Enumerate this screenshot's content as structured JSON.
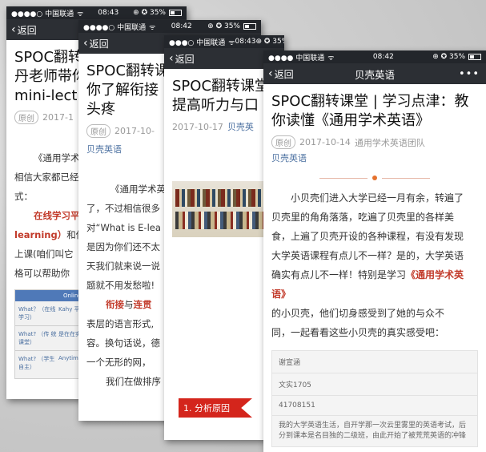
{
  "phone1": {
    "status": {
      "carrier": "●●●●○ 中国联通",
      "wifi": "ᯤ",
      "time": "08:43",
      "right": "⊕ ✪ 35%"
    },
    "back": "返回",
    "title": "SPOC翻转课堂 | 学习点津：教丹老师带你学mini-lecture",
    "title_lines": [
      "SPOC翻转",
      "丹老师带你",
      "mini-lectu"
    ],
    "tag": "原创",
    "date": "2017-1",
    "para1": "《通用学术",
    "para2": "相信大家都已经",
    "para3": "式：",
    "red1": "在线学习平",
    "red2": "learning）",
    "para4": "和你",
    "para5": "上课(咱们叫它",
    "para6": "格可以帮助你",
    "table_header": "Online lea",
    "table_rows": [
      "What？（在线 学习）",
      "What? （传 统课堂）",
      "What? （学生 自主）"
    ],
    "table_cells": [
      "Kahy 平 Rea 在平台的课程",
      "是在在实现的 来查查学是老 与课程中平学",
      "Anytime"
    ]
  },
  "phone2": {
    "status": {
      "carrier": "●●●●○ 中国联通",
      "wifi": "ᯤ",
      "time": "08:42",
      "right": "⊕ ✪ 35%"
    },
    "back": "返回",
    "title_lines": [
      "SPOC翻转课",
      "你了解衔接",
      "头疼"
    ],
    "tag": "原创",
    "date": "2017-10-",
    "author": "贝壳英语",
    "para1": "《通用学术英",
    "para2": "了，不过相信很多",
    "para3": "对“What is E-lea",
    "para4": "是因为你们还不太",
    "para5": "天我们就来说一说",
    "para6": "题就不用发愁啦!",
    "red_a": "衔接",
    "red_mid": "与",
    "red_b": "连贯",
    "para7": "表层的语言形式,",
    "para8": "容。换句话说，德",
    "para9": "一个无形的网，",
    "para10": "我们在做排序"
  },
  "phone3": {
    "status": {
      "carrier": "●●●○ 中国联通",
      "wifi": "ᯤ",
      "time": "08:43",
      "right": "⊕ ✪ 35%"
    },
    "back": "返回",
    "title_lines": [
      "SPOC翻转课堂",
      "提高听力与口"
    ],
    "date": "2017-10-17",
    "author": "贝壳英",
    "banner": "1. 分析原因"
  },
  "phone4": {
    "status": {
      "carrier": "●●●● 中国联通",
      "wifi": "ᯤ",
      "time": "08:42",
      "right": "⊕ ✪ 35%"
    },
    "back": "返回",
    "nav_title": "贝壳英语",
    "more": "•••",
    "title_lines": [
      "SPOC翻转课堂 | 学习点津：教",
      "你读懂《通用学术英语》"
    ],
    "tag": "原创",
    "date": "2017-10-14",
    "team": "通用学术英语团队",
    "author": "贝壳英语",
    "body_lines": [
      "小贝壳们进入大学已经一月有余，转遍了",
      "贝壳里的角角落落，吃遍了贝壳里的各样美",
      "食，上遍了贝壳开设的各种课程，有没有发现",
      "大学英语课程有点儿不一样？是的，大学英语",
      "确实有点儿不一样！特别是学习"
    ],
    "highlight": "《通用学术英语》",
    "body_after": "的小贝壳，他们切身感受到了她的与众不",
    "body_last": "同，一起看看这些小贝壳的真实感受吧：",
    "card_rows": [
      "谢宣涵",
      "文实1705",
      "41708151"
    ],
    "card_body": "我的大学英语生活，自开学那一次云里雾里的英语考试，后分到课本是名目独的二级班，由此开始了被荒荒英语的冲锋"
  },
  "colors": {
    "statusbar": "#23262b",
    "navbar": "#2c2f34",
    "red": "#c23a2a",
    "link": "#4a6fa0",
    "orange": "#e5722e"
  }
}
